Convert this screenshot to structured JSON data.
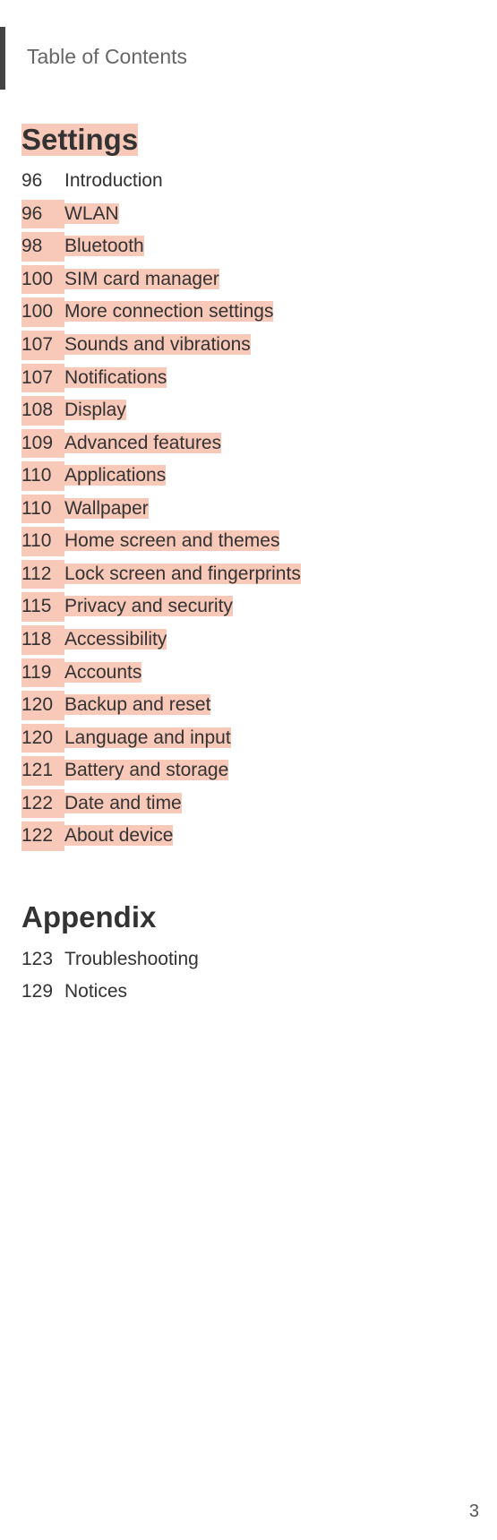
{
  "header": {
    "title": "Table of Contents"
  },
  "sections": [
    {
      "heading": "Settings",
      "headingHighlighted": true,
      "entries": [
        {
          "page": "96",
          "title": "Introduction",
          "highlighted": false
        },
        {
          "page": "96",
          "title": "WLAN",
          "highlighted": true
        },
        {
          "page": "98",
          "title": "Bluetooth",
          "highlighted": true
        },
        {
          "page": "100",
          "title": "SIM card manager",
          "highlighted": true
        },
        {
          "page": "100",
          "title": "More connection settings",
          "highlighted": true
        },
        {
          "page": "107",
          "title": "Sounds and vibrations",
          "highlighted": true
        },
        {
          "page": "107",
          "title": "Notifications",
          "highlighted": true
        },
        {
          "page": "108",
          "title": "Display",
          "highlighted": true
        },
        {
          "page": "109",
          "title": "Advanced features",
          "highlighted": true
        },
        {
          "page": "110",
          "title": "Applications",
          "highlighted": true
        },
        {
          "page": "110",
          "title": "Wallpaper",
          "highlighted": true
        },
        {
          "page": "110",
          "title": "Home screen and themes",
          "highlighted": true
        },
        {
          "page": "112",
          "title": "Lock screen and fingerprints",
          "highlighted": true
        },
        {
          "page": "115",
          "title": "Privacy and security",
          "highlighted": true
        },
        {
          "page": "118",
          "title": "Accessibility",
          "highlighted": true
        },
        {
          "page": "119",
          "title": "Accounts",
          "highlighted": true
        },
        {
          "page": "120",
          "title": "Backup and reset",
          "highlighted": true
        },
        {
          "page": "120",
          "title": "Language and input",
          "highlighted": true
        },
        {
          "page": "121",
          "title": "Battery and storage",
          "highlighted": true
        },
        {
          "page": "122",
          "title": "Date and time",
          "highlighted": true
        },
        {
          "page": "122",
          "title": "About device",
          "highlighted": true
        }
      ]
    },
    {
      "heading": "Appendix",
      "headingHighlighted": false,
      "entries": [
        {
          "page": "123",
          "title": "Troubleshooting",
          "highlighted": false
        },
        {
          "page": "129",
          "title": "Notices",
          "highlighted": false
        }
      ]
    }
  ],
  "footer": {
    "pageNumber": "3"
  }
}
